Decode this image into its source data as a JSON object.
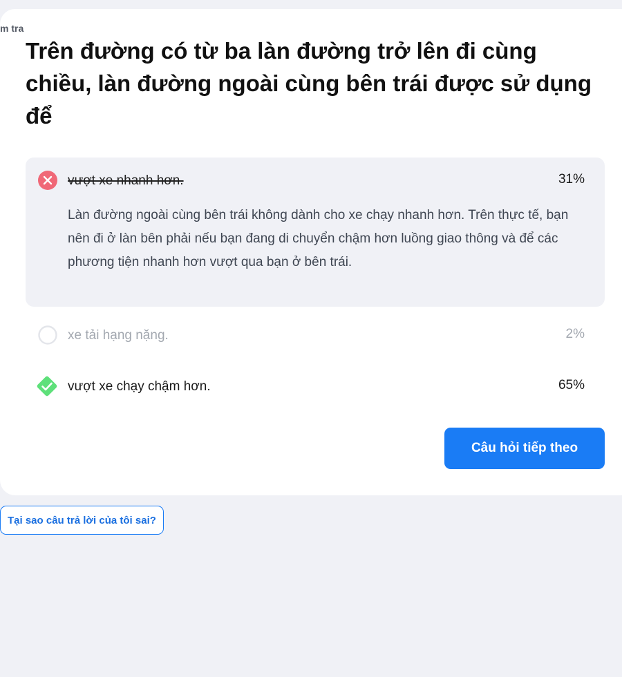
{
  "breadcrumb": "m tra",
  "question": "Trên đường có từ ba làn đường trở lên đi cùng chiều, làn đường ngoài cùng bên trái được sử dụng để",
  "options": [
    {
      "label": "vượt xe nhanh hơn.",
      "percent": "31%",
      "status": "wrong",
      "icon": "x-circle-icon",
      "explanation": "Làn đường ngoài cùng bên trái không dành cho xe chạy nhanh hơn. Trên thực tế, bạn nên đi ở làn bên phải nếu bạn đang di chuyển chậm hơn luồng giao thông và để các phương tiện nhanh hơn vượt qua bạn ở bên trái."
    },
    {
      "label": "xe tải hạng nặng.",
      "percent": "2%",
      "status": "neutral",
      "icon": "empty-circle-icon"
    },
    {
      "label": "vượt xe chạy chậm hơn.",
      "percent": "65%",
      "status": "correct",
      "icon": "check-diamond-icon"
    }
  ],
  "buttons": {
    "next": "Câu hỏi tiếp theo",
    "why_wrong": "Tại sao câu trả lời của tôi sai?"
  },
  "colors": {
    "wrong": "#f06877",
    "correct": "#5ee07a",
    "accent": "#1a7cf5",
    "background": "#f0f1f6"
  }
}
